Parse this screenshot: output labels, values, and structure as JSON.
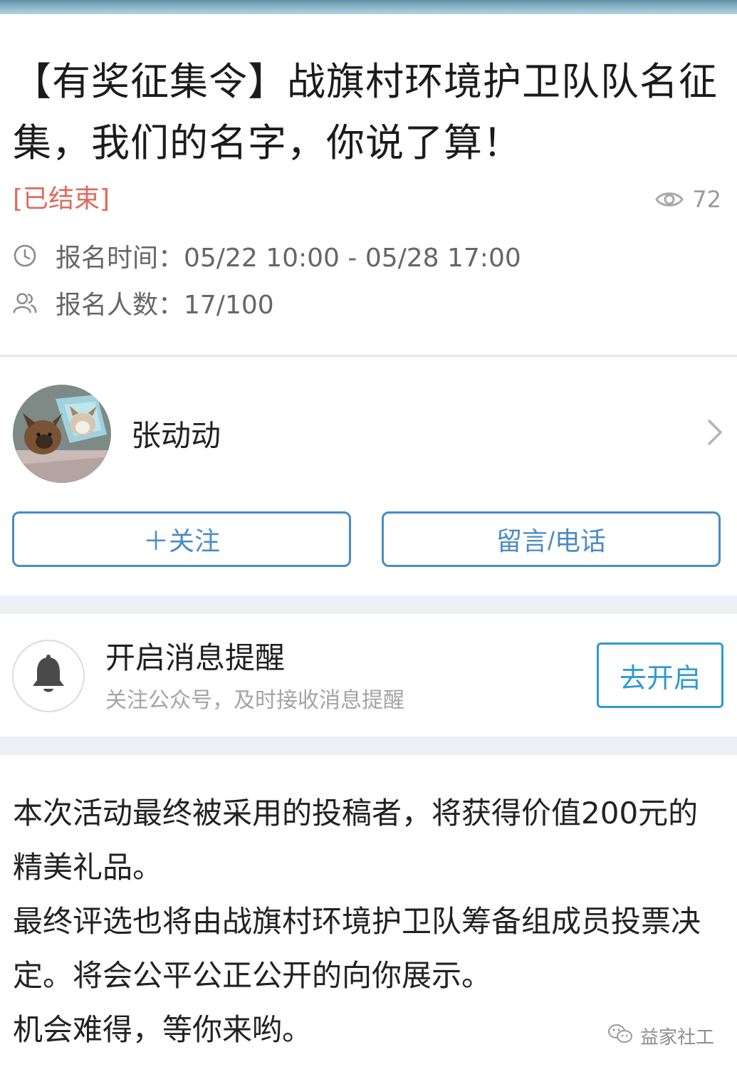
{
  "header": {
    "title": "【有奖征集令】战旗村环境护卫队队名征集，我们的名字，你说了算！",
    "status": "[已结束]",
    "views": "72",
    "time_row": "报名时间：05/22 10:00 - 05/28 17:00",
    "count_row": "报名人数：17/100"
  },
  "author": {
    "name": "张动动",
    "follow_label": "＋关注",
    "message_label": "留言/电话"
  },
  "notify": {
    "title": "开启消息提醒",
    "subtitle": "关注公众号，及时接收消息提醒",
    "enable_label": "去开启"
  },
  "content": {
    "p1": "本次活动最终被采用的投稿者，将获得价值200元的精美礼品。",
    "p2": "最终评选也将由战旗村环境护卫队筹备组成员投票决定。将会公平公正公开的向你展示。",
    "p3": "机会难得，等你来哟。"
  },
  "watermark": {
    "text": "益家社工"
  },
  "colors": {
    "accent_blue": "#4a8cc5",
    "enable_blue": "#2f9ad1",
    "status_red": "#e2695a",
    "band_gray": "#eef0f5"
  },
  "icons": {
    "views": "eye-icon",
    "time": "clock-icon",
    "count": "people-icon",
    "chevron": "chevron-right-icon",
    "bell": "bell-icon",
    "watermark": "wechat-icon"
  }
}
